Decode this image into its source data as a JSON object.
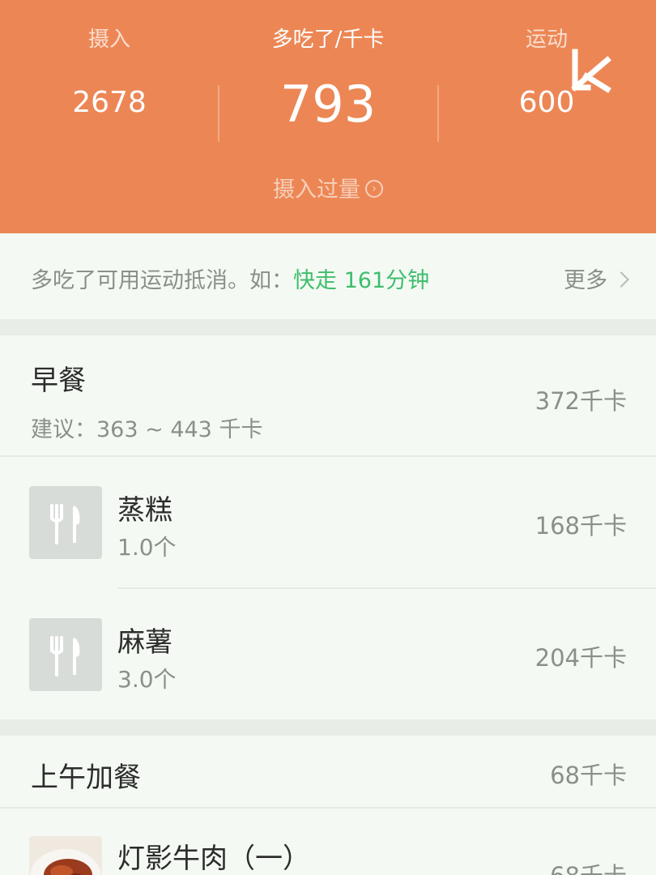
{
  "theme": {
    "accent": "#ec8755",
    "highlight": "#3fbd6d"
  },
  "summary": {
    "intake_label": "摄入",
    "intake_value": "2678",
    "over_label": "多吃了/千卡",
    "over_value": "793",
    "exercise_label": "运动",
    "exercise_value": "600",
    "status_text": "摄入过量",
    "status_icon": "chevron-circle-right-icon",
    "brand_icon": "k-logo-icon"
  },
  "tip": {
    "text": "多吃了可用运动抵消。如：",
    "highlight": "快走 161分钟",
    "more_label": "更多"
  },
  "meals": [
    {
      "name": "早餐",
      "suggestion": "建议：363 ~ 443 千卡",
      "kcal": "372千卡",
      "foods": [
        {
          "name": "蒸糕",
          "qty": "1.0个",
          "kcal": "168千卡",
          "icon": "fork-knife-icon"
        },
        {
          "name": "麻薯",
          "qty": "3.0个",
          "kcal": "204千卡",
          "icon": "fork-knife-icon"
        }
      ]
    },
    {
      "name": "上午加餐",
      "kcal": "68千卡",
      "foods": [
        {
          "name": "灯影牛肉（一）",
          "kcal": "68千卡",
          "icon": "food-photo"
        }
      ]
    }
  ]
}
